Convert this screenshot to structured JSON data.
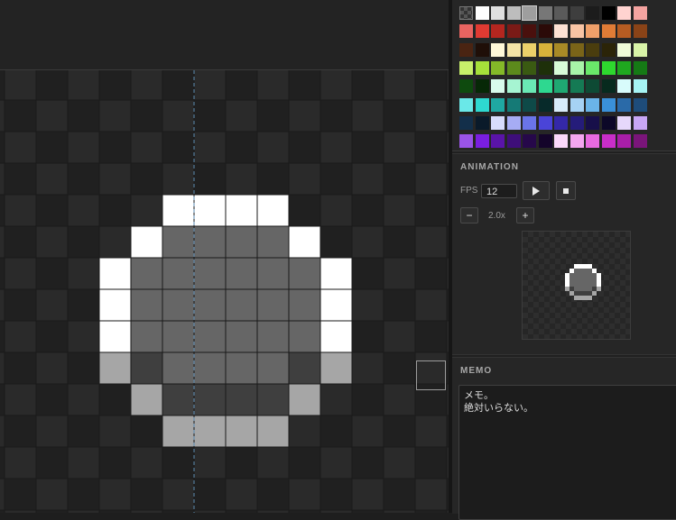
{
  "canvas": {
    "checker_dark": "#202020",
    "checker_light": "#2a2a2a",
    "grid_line": "#1a1a1a",
    "center_guide_color": "#5a8ab0",
    "sprite_colors": {
      "W": "#ffffff",
      "M": "#666666",
      "L": "#a6a6a6",
      "D": "#3f3f3f"
    },
    "sprite_rows": [
      "",
      "",
      "",
      "",
      "....WWWW....",
      "...WMMMMW...",
      "..WMMMMMMW..",
      "..WMMMMMMW..",
      "..WMMMMMMW..",
      "..LDMMMMDL..",
      "...LDDDDL...",
      "....LLLL...."
    ]
  },
  "palette": {
    "colors": [
      "transparent",
      "#ffffff",
      "#e0e0e0",
      "#bdbdbd",
      "#9e9e9e",
      "#777777",
      "#5a5a5a",
      "#3e3e3e",
      "#1c1c1c",
      "#000000",
      "#ffd3d0",
      "#f4a3a0",
      "#e86461",
      "#e03a32",
      "#b5261f",
      "#7a1a16",
      "#4a100d",
      "#2b0a08",
      "#fde2d4",
      "#f8c4a4",
      "#f0a06a",
      "#e07c36",
      "#b65c22",
      "#8a4317",
      "#4a2412",
      "#1f0f08",
      "#fff8d8",
      "#f5e4a6",
      "#ecd06a",
      "#d8b23a",
      "#a88a26",
      "#7a6418",
      "#4a3d0e",
      "#2b2408",
      "#f0fbd8",
      "#d9f4a8",
      "#c8f06a",
      "#a6e03a",
      "#84b828",
      "#5c8a1c",
      "#3a5a12",
      "#1e300a",
      "#d8fbd8",
      "#a8f4a8",
      "#6ae86a",
      "#2ed82e",
      "#1fa81f",
      "#157a15",
      "#0e4a0e",
      "#072807",
      "#d8fbec",
      "#a6f4d2",
      "#6ae8b4",
      "#2ed890",
      "#1fa872",
      "#157a54",
      "#0e4a34",
      "#072a1e",
      "#d8fbfb",
      "#a6f4f4",
      "#6ae8e8",
      "#2ed8d0",
      "#1fa8a2",
      "#157a76",
      "#0e4a48",
      "#072a2a",
      "#d8ecfb",
      "#a6d2f4",
      "#6ab4e8",
      "#3a90d8",
      "#2a6aa8",
      "#1e4c7a",
      "#132f4a",
      "#0a1a2a",
      "#d8dcfb",
      "#a6acf4",
      "#6a74e8",
      "#4a44d8",
      "#3428a8",
      "#251c7a",
      "#170f4a",
      "#0c0828",
      "#e6d8fb",
      "#c8a6f4",
      "#9a54e8",
      "#7a1ee0",
      "#5a14a8",
      "#3e0e7a",
      "#26084a",
      "#14042a",
      "#fbd8fb",
      "#f4a6f0",
      "#e86ae0",
      "#c82ec8",
      "#a81ea8",
      "#7a157a"
    ],
    "selected_index": 4
  },
  "animation": {
    "title": "ANIMATION",
    "fps_label": "FPS",
    "fps_value": "12",
    "play_icon": "play-icon",
    "stop_icon": "stop-icon",
    "minus_label": "−",
    "plus_label": "+",
    "scale_label": "2.0x"
  },
  "memo": {
    "title": "MEMO",
    "text": "メモ。\n絶対いらない。"
  }
}
